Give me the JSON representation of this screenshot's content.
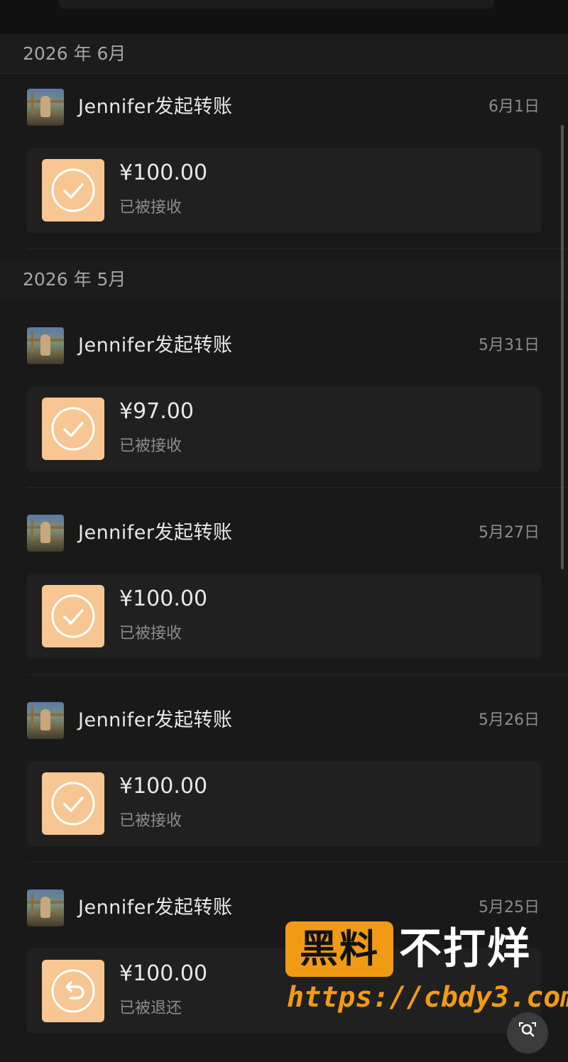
{
  "months": [
    {
      "label": "2026 年 6月"
    },
    {
      "label": "2026 年 5月"
    }
  ],
  "records": [
    {
      "sender": "Jennifer发起转账",
      "date": "6月1日",
      "amount": "¥100.00",
      "status": "已被接收",
      "icon": "check-icon"
    },
    {
      "sender": "Jennifer发起转账",
      "date": "5月31日",
      "amount": "¥97.00",
      "status": "已被接收",
      "icon": "check-icon"
    },
    {
      "sender": "Jennifer发起转账",
      "date": "5月27日",
      "amount": "¥100.00",
      "status": "已被接收",
      "icon": "check-icon"
    },
    {
      "sender": "Jennifer发起转账",
      "date": "5月26日",
      "amount": "¥100.00",
      "status": "已被接收",
      "icon": "check-icon"
    },
    {
      "sender": "Jennifer发起转账",
      "date": "5月25日",
      "amount": "¥100.00",
      "status": "已被退还",
      "icon": "return-icon"
    }
  ],
  "watermark": {
    "brand_box": "黑料",
    "brand_text": "不打烊",
    "url": "https://cbdy3.com"
  },
  "colors": {
    "background": "#191919",
    "badge": "#f7c692",
    "watermark_accent": "#f19b14"
  }
}
